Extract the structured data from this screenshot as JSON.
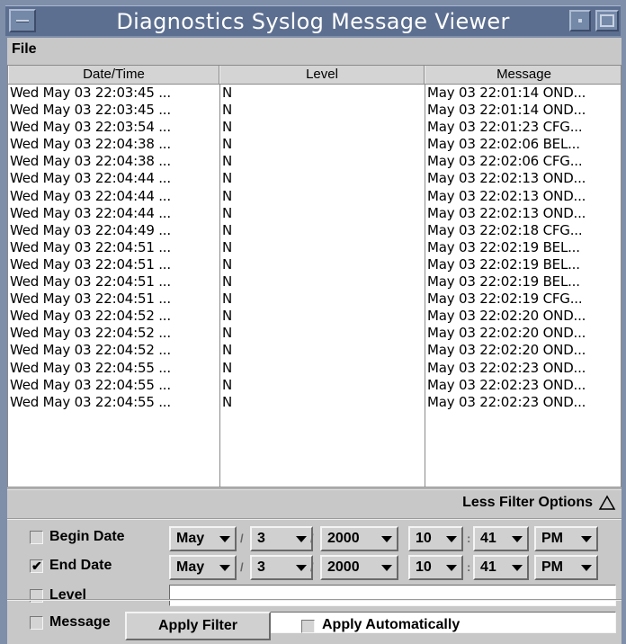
{
  "window": {
    "title": "Diagnostics Syslog Message Viewer"
  },
  "menu": {
    "file": "File"
  },
  "table": {
    "headers": {
      "date": "Date/Time",
      "level": "Level",
      "message": "Message"
    },
    "rows": [
      {
        "date": "Wed May 03 22:03:45 ...",
        "level": "N",
        "message": "May 03 22:01:14 OND..."
      },
      {
        "date": "Wed May 03 22:03:45 ...",
        "level": "N",
        "message": "May 03 22:01:14 OND..."
      },
      {
        "date": "Wed May 03 22:03:54 ...",
        "level": "N",
        "message": "May 03 22:01:23 CFG..."
      },
      {
        "date": "Wed May 03 22:04:38 ...",
        "level": "N",
        "message": "May 03 22:02:06 BEL..."
      },
      {
        "date": "Wed May 03 22:04:38 ...",
        "level": "N",
        "message": "May 03 22:02:06 CFG..."
      },
      {
        "date": "Wed May 03 22:04:44 ...",
        "level": "N",
        "message": "May 03 22:02:13 OND..."
      },
      {
        "date": "Wed May 03 22:04:44 ...",
        "level": "N",
        "message": "May 03 22:02:13 OND..."
      },
      {
        "date": "Wed May 03 22:04:44 ...",
        "level": "N",
        "message": "May 03 22:02:13 OND..."
      },
      {
        "date": "Wed May 03 22:04:49 ...",
        "level": "N",
        "message": "May 03 22:02:18 CFG..."
      },
      {
        "date": "Wed May 03 22:04:51 ...",
        "level": "N",
        "message": "May 03 22:02:19 BEL..."
      },
      {
        "date": "Wed May 03 22:04:51 ...",
        "level": "N",
        "message": "May 03 22:02:19 BEL..."
      },
      {
        "date": "Wed May 03 22:04:51 ...",
        "level": "N",
        "message": "May 03 22:02:19 BEL..."
      },
      {
        "date": "Wed May 03 22:04:51 ...",
        "level": "N",
        "message": "May 03 22:02:19 CFG..."
      },
      {
        "date": "Wed May 03 22:04:52 ...",
        "level": "N",
        "message": "May 03 22:02:20 OND..."
      },
      {
        "date": "Wed May 03 22:04:52 ...",
        "level": "N",
        "message": "May 03 22:02:20 OND..."
      },
      {
        "date": "Wed May 03 22:04:52 ...",
        "level": "N",
        "message": "May 03 22:02:20 OND..."
      },
      {
        "date": "Wed May 03 22:04:55 ...",
        "level": "N",
        "message": "May 03 22:02:23 OND..."
      },
      {
        "date": "Wed May 03 22:04:55 ...",
        "level": "N",
        "message": "May 03 22:02:23 OND..."
      },
      {
        "date": "Wed May 03 22:04:55 ...",
        "level": "N",
        "message": "May 03 22:02:23 OND..."
      }
    ]
  },
  "filter": {
    "toggle_label": "Less Filter Options",
    "begin_date": {
      "label": "Begin Date",
      "checked": false,
      "month": "May",
      "day": "3",
      "year": "2000",
      "hour": "10",
      "minute": "41",
      "ampm": "PM"
    },
    "end_date": {
      "label": "End Date",
      "checked": true,
      "month": "May",
      "day": "3",
      "year": "2000",
      "hour": "10",
      "minute": "41",
      "ampm": "PM"
    },
    "level": {
      "label": "Level",
      "checked": false,
      "value": ""
    },
    "message": {
      "label": "Message",
      "checked": false,
      "value": ""
    },
    "date_sep": "/",
    "time_sep": ":",
    "check_mark": "✔"
  },
  "actions": {
    "apply_filter": "Apply Filter",
    "apply_auto": "Apply Automatically",
    "apply_auto_checked": false
  }
}
